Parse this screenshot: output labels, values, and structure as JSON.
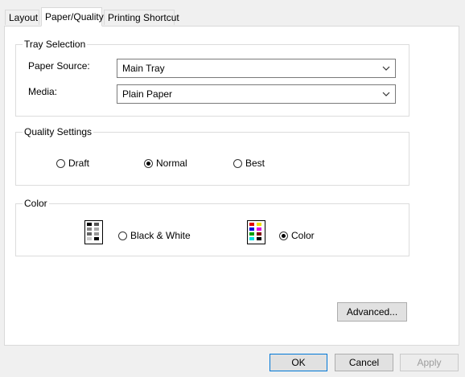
{
  "tabs": [
    "Layout",
    "Paper/Quality",
    "Printing Shortcut"
  ],
  "tray_selection": {
    "title": "Tray Selection",
    "paper_source_label": "Paper Source:",
    "paper_source_value": "Main Tray",
    "media_label": "Media:",
    "media_value": "Plain Paper"
  },
  "quality": {
    "title": "Quality Settings",
    "options": [
      "Draft",
      "Normal",
      "Best"
    ],
    "selected": "Normal"
  },
  "color": {
    "title": "Color",
    "options": [
      "Black & White",
      "Color"
    ],
    "selected": "Color"
  },
  "buttons": {
    "advanced": "Advanced...",
    "ok": "OK",
    "cancel": "Cancel",
    "apply": "Apply"
  }
}
